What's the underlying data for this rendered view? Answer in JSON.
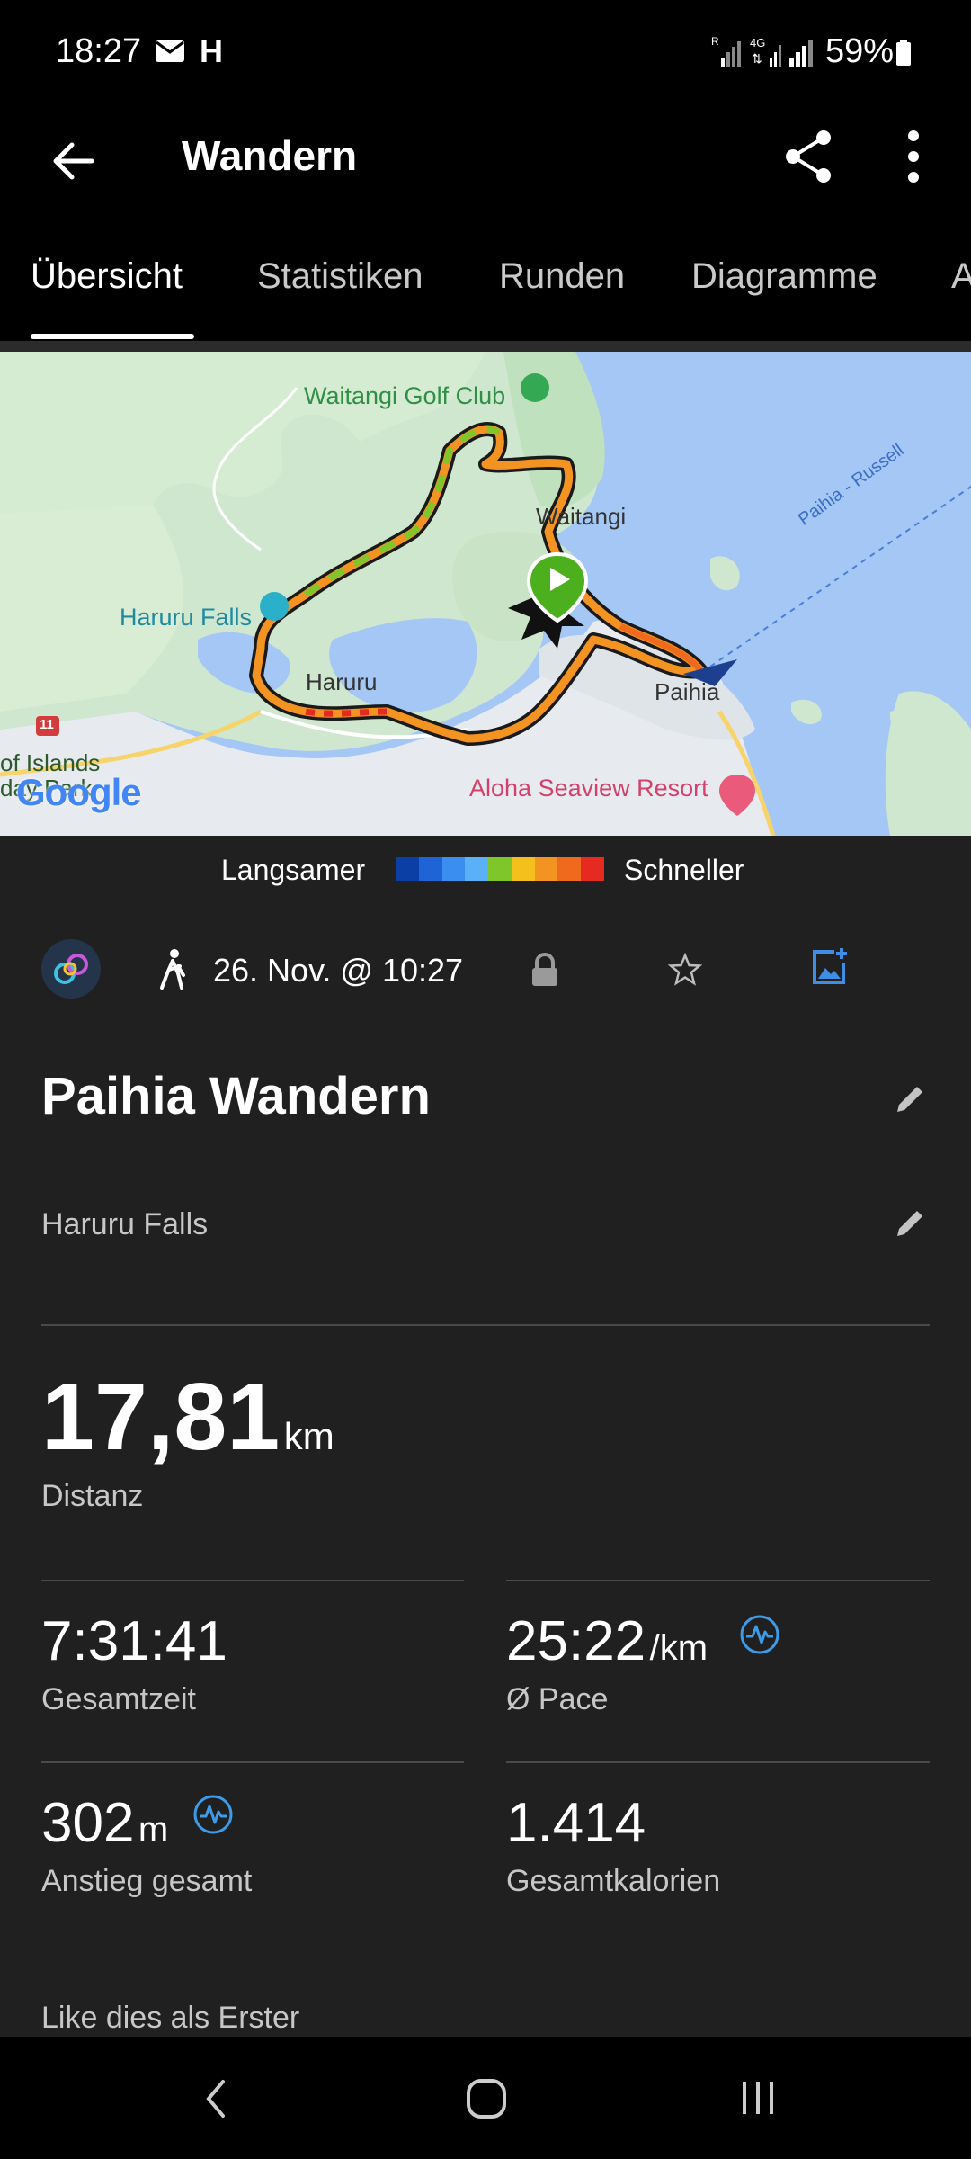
{
  "status": {
    "time": "18:27",
    "carrier_icon": "H",
    "battery": "59%"
  },
  "appbar": {
    "title": "Wandern"
  },
  "tabs": [
    {
      "label": "Übersicht",
      "active": true
    },
    {
      "label": "Statistiken"
    },
    {
      "label": "Runden"
    },
    {
      "label": "Diagramme"
    },
    {
      "label": "A"
    }
  ],
  "map": {
    "labels": {
      "golf": "Waitangi Golf Club",
      "falls": "Haruru Falls",
      "waitangi": "Waitangi",
      "haruru": "Haruru",
      "paihia": "Paihia",
      "ferry": "Paihia - Russell",
      "resort": "Aloha Seaview Resort",
      "islands": "of Islands",
      "islands2": "day Park",
      "road": "11",
      "google": "Google"
    }
  },
  "legend": {
    "slow": "Langsamer",
    "fast": "Schneller",
    "colors": [
      "#0b3fa6",
      "#1e64d6",
      "#3a8ef0",
      "#5bb1f7",
      "#7ec62a",
      "#f3c01c",
      "#f39422",
      "#f06a1e",
      "#e62a22"
    ]
  },
  "info": {
    "activity_icon": "hiking-icon",
    "datetime": "26. Nov. @ 10:27"
  },
  "activity": {
    "title": "Paihia Wandern",
    "location": "Haruru Falls"
  },
  "stats": {
    "distance": {
      "value": "17,81",
      "unit": "km",
      "label": "Distanz"
    },
    "total_time": {
      "value": "7:31:41",
      "label": "Gesamtzeit"
    },
    "pace": {
      "value": "25:22",
      "unit": "/km",
      "label": "Ø Pace"
    },
    "ascent": {
      "value": "302",
      "unit": "m",
      "label": "Anstieg gesamt"
    },
    "calories": {
      "value": "1.414",
      "label": "Gesamtkalorien"
    }
  },
  "social": {
    "like_text": "Like dies als Erster"
  }
}
